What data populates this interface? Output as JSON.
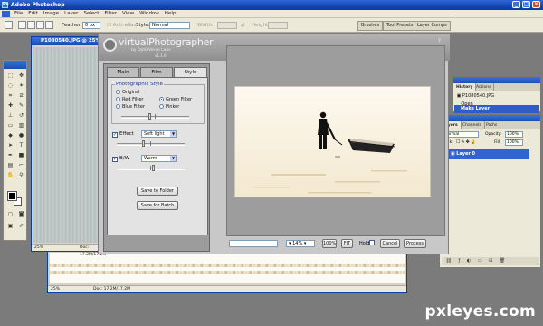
{
  "window": {
    "title": "Adobe Photoshop"
  },
  "menu": [
    "File",
    "Edit",
    "Image",
    "Layer",
    "Select",
    "Filter",
    "View",
    "Window",
    "Help"
  ],
  "options_bar": {
    "feather_label": "Feather:",
    "feather_value": "0 px",
    "antialiased_label": "Anti-alias",
    "style_label": "Style:",
    "style_value": "Normal",
    "width_label": "Width:",
    "height_label": "Height:",
    "wells": [
      "Brushes",
      "Tool Presets",
      "Layer Comps"
    ]
  },
  "document_front": {
    "title": "P1080540.JPG @ 25%",
    "zoom": "25%",
    "doc_size": "Doc: 17.2M/17.2M"
  },
  "document_back": {
    "zoom": "25%",
    "doc_size": "Doc: 17.2M/17.2M"
  },
  "plugin": {
    "title": "virtualPhotographer",
    "subtitle": "by OptikVerve Labs",
    "version": "v1.1.0",
    "tabs": [
      "Main",
      "Film",
      "Style"
    ],
    "active_tab": "Style",
    "photographic_style": {
      "label": "Photographic Style",
      "options": [
        "Original",
        "Red Filter",
        "Green Filter",
        "Blue Filter",
        "Pinker"
      ],
      "selected": "Green Filter",
      "level": 0.42
    },
    "effect": {
      "label": "Effect",
      "checked": true,
      "value": "Soft light",
      "level": 0.4
    },
    "bw": {
      "label": "B/W",
      "checked": true,
      "value": "Warm",
      "level": 0.55
    },
    "save_folder_label": "Save to Folder",
    "save_batch_label": "Save for Batch",
    "zoom_value": "14%",
    "zoom_100_label": "100%",
    "fit_label": "FIT",
    "hold_label": "Hold",
    "cancel_label": "Cancel",
    "process_label": "Process"
  },
  "history_panel": {
    "tabs": [
      "History",
      "Actions"
    ],
    "snapshot": "P1080540.JPG",
    "items": [
      "Open",
      "Make Layer"
    ],
    "selected": "Make Layer"
  },
  "layers_panel": {
    "tabs": [
      "Layers",
      "Channels",
      "Paths"
    ],
    "blend_mode": "Normal",
    "opacity_label": "Opacity:",
    "opacity_value": "100%",
    "lock_label": "Lock:",
    "fill_label": "Fill:",
    "fill_value": "100%",
    "layers": [
      "Layer 0"
    ]
  },
  "watermark": "pxleyes.com"
}
